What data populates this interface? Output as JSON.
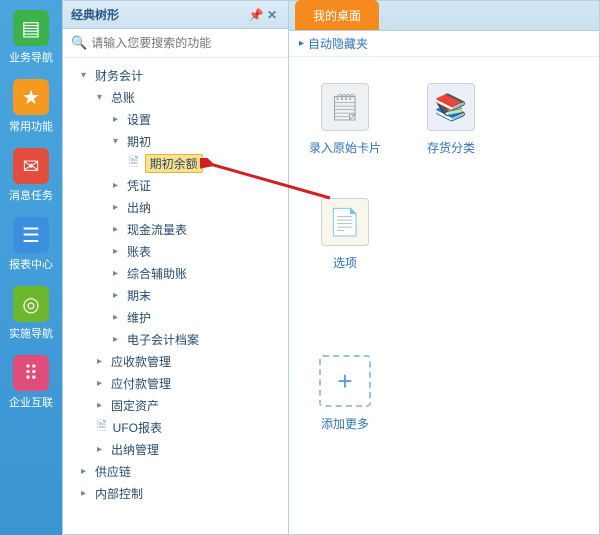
{
  "left_nav": {
    "items": [
      {
        "label": "业务导航"
      },
      {
        "label": "常用功能"
      },
      {
        "label": "消息任务"
      },
      {
        "label": "报表中心"
      },
      {
        "label": "实施导航"
      },
      {
        "label": "企业互联"
      }
    ]
  },
  "tree_panel": {
    "title": "经典树形",
    "search_placeholder": "请输入您要搜索的功能"
  },
  "tree": {
    "root": "财务会计",
    "l2_gl": "总账",
    "l3_settings": "设置",
    "l3_opening": "期初",
    "l4_opening_balance": "期初余额",
    "l3_voucher": "凭证",
    "l3_cashier": "出纳",
    "l3_cashflow": "现金流量表",
    "l3_books": "账表",
    "l3_aux": "综合辅助账",
    "l3_period_end": "期末",
    "l3_maintain": "维护",
    "l3_earchive": "电子会计档案",
    "l2_ar": "应收款管理",
    "l2_ap": "应付款管理",
    "l2_fa": "固定资产",
    "l2_ufo": "UFO报表",
    "l2_cashier_mgmt": "出纳管理",
    "root2": "供应链",
    "root3": "内部控制"
  },
  "workspace": {
    "tab_active": "我的桌面",
    "fav_label": "自动隐藏夹",
    "tiles": [
      {
        "label": "录入原始卡片"
      },
      {
        "label": "存货分类"
      },
      {
        "label": "选项"
      }
    ],
    "add_more": "添加更多"
  }
}
